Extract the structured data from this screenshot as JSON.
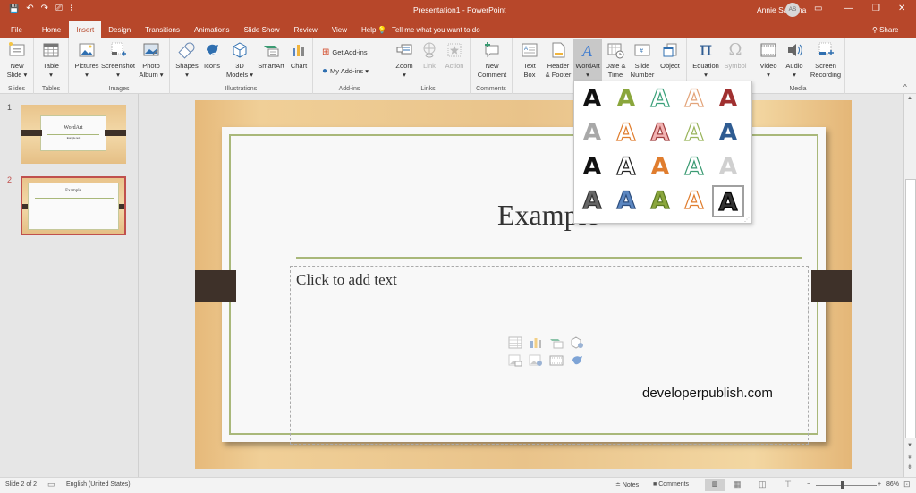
{
  "app": {
    "doc_title": "Presentation1  -  PowerPoint",
    "user_name": "Annie Sanjana",
    "user_initials": "AS",
    "tell_me": "Tell me what you want to do",
    "share": "Share"
  },
  "qat": {
    "save": "💾",
    "undo": "↶",
    "redo": "↷",
    "present": "⎚",
    "more": "⁝"
  },
  "window": {
    "ribbon_display": "▭",
    "minimize": "—",
    "restore": "❐",
    "close": "✕"
  },
  "tabs": [
    {
      "label": "File"
    },
    {
      "label": "Home"
    },
    {
      "label": "Insert"
    },
    {
      "label": "Design"
    },
    {
      "label": "Transitions"
    },
    {
      "label": "Animations"
    },
    {
      "label": "Slide Show"
    },
    {
      "label": "Review"
    },
    {
      "label": "View"
    },
    {
      "label": "Help"
    }
  ],
  "ribbon": {
    "groups": {
      "slides": "Slides",
      "tables": "Tables",
      "images": "Images",
      "illustrations": "Illustrations",
      "addins": "Add-ins",
      "links": "Links",
      "comments": "Comments",
      "text": "",
      "symbols": "",
      "media": "Media"
    },
    "buttons": {
      "new_slide": [
        "New",
        "Slide ▾"
      ],
      "table": [
        "Table",
        "▾"
      ],
      "pictures": [
        "Pictures",
        "▾"
      ],
      "screenshot": [
        "Screenshot",
        "▾"
      ],
      "photo_album": [
        "Photo",
        "Album ▾"
      ],
      "shapes": [
        "Shapes",
        "▾"
      ],
      "icons": [
        "Icons",
        ""
      ],
      "models_3d": [
        "3D",
        "Models ▾"
      ],
      "smartart": [
        "SmartArt",
        ""
      ],
      "chart": [
        "Chart",
        ""
      ],
      "get_addins": "Get Add-ins",
      "my_addins": "My Add-ins  ▾",
      "zoom": [
        "Zoom",
        "▾"
      ],
      "link": [
        "Link",
        ""
      ],
      "action": [
        "Action",
        ""
      ],
      "new_comment": [
        "New",
        "Comment"
      ],
      "text_box": [
        "Text",
        "Box"
      ],
      "header_footer": [
        "Header",
        "& Footer"
      ],
      "wordart": [
        "WordArt",
        "▾"
      ],
      "date_time": [
        "Date &",
        "Time"
      ],
      "slide_number": [
        "Slide",
        "Number"
      ],
      "object": [
        "Object",
        ""
      ],
      "equation": [
        "Equation",
        "▾"
      ],
      "symbol": [
        "Symbol",
        ""
      ],
      "video": [
        "Video",
        "▾"
      ],
      "audio": [
        "Audio",
        "▾"
      ],
      "screen_recording": [
        "Screen",
        "Recording"
      ]
    }
  },
  "wordart_styles": [
    {
      "fill": "#111111",
      "stroke": "none"
    },
    {
      "fill": "#8aa63c",
      "stroke": "none"
    },
    {
      "fill": "#ffffff",
      "stroke": "#3aa07a"
    },
    {
      "fill": "#ffffff",
      "stroke": "#e3a47a"
    },
    {
      "fill": "#a03030",
      "stroke": "none"
    },
    {
      "fill": "#a8a8a8",
      "stroke": "none"
    },
    {
      "fill": "#ffffff",
      "stroke": "#e07d2e"
    },
    {
      "fill": "#f2b3b3",
      "stroke": "#a04040"
    },
    {
      "fill": "#ffffff",
      "stroke": "#9ab55c"
    },
    {
      "fill": "#2f5c92",
      "stroke": "none"
    },
    {
      "fill": "#111111",
      "stroke": "none"
    },
    {
      "fill": "#ffffff",
      "stroke": "#222222"
    },
    {
      "fill": "#e07d2e",
      "stroke": "none"
    },
    {
      "fill": "#ffffff",
      "stroke": "#3a9a72"
    },
    {
      "fill": "#d0d0d0",
      "stroke": "none"
    },
    {
      "fill": "#666666",
      "stroke": "#333333"
    },
    {
      "fill": "#5b86c0",
      "stroke": "#2d4e7e"
    },
    {
      "fill": "#8aa63c",
      "stroke": "#5c7a22"
    },
    {
      "fill": "#ffffff",
      "stroke": "#e07d2e"
    },
    {
      "fill": "#333333",
      "stroke": "#000000",
      "selected": true
    }
  ],
  "wordart_glyph": "A",
  "thumbnails": [
    {
      "number": "1",
      "title": "WordArt",
      "subtitle": "Example text"
    },
    {
      "number": "2",
      "title": "Example"
    }
  ],
  "slide": {
    "title": "Example",
    "body_placeholder": "Click to add text",
    "watermark": "developerpublish.com"
  },
  "status": {
    "slide_info": "Slide 2 of 2",
    "language": "English (United States)",
    "notes": "Notes",
    "comments": "Comments",
    "zoom_percent": 86,
    "zoom_label": "86%"
  },
  "colors": {
    "accent": "#b7472a",
    "frame": "#a9b87a",
    "strap": "#3e3129"
  }
}
